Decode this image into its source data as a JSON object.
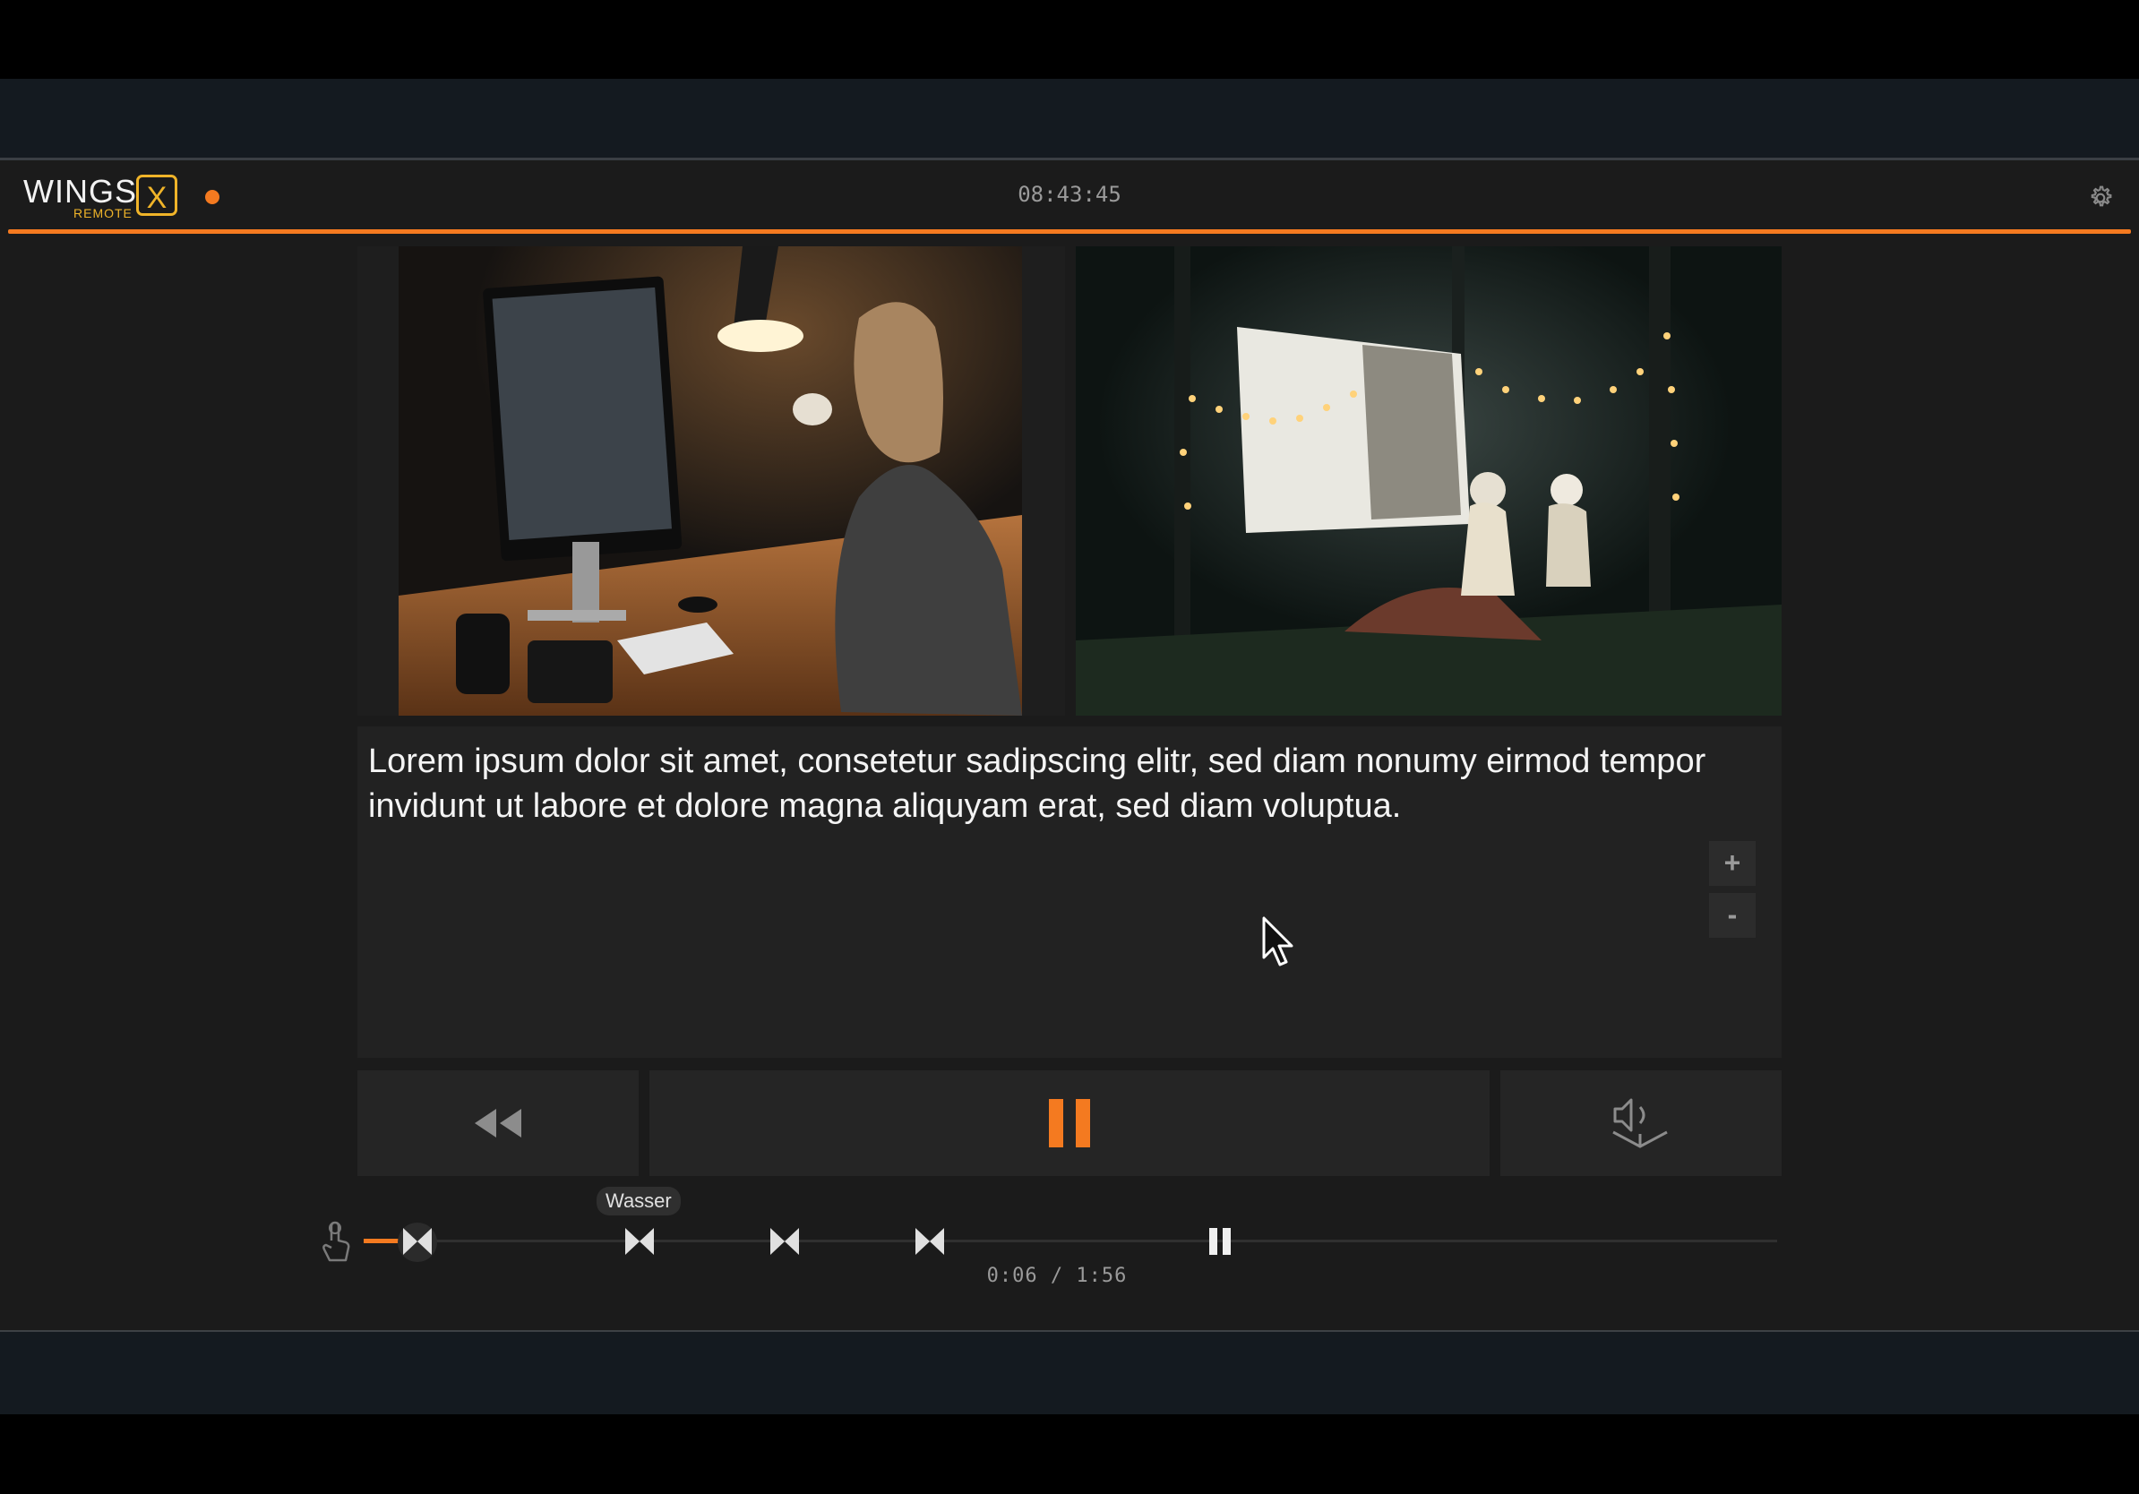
{
  "app": {
    "logo_word": "WINGS",
    "logo_sub": "REMOTE",
    "logo_x": "X",
    "clock": "08:43:45"
  },
  "media": {
    "images": [
      "Person at desk with iMac holding a mug",
      "Outdoor night movie screen in forest with lights"
    ]
  },
  "caption": {
    "text": "Lorem ipsum dolor sit amet, consetetur sadipscing elitr, sed diam nonumy eirmod tempor invidunt ut labore et dolore magna aliquyam erat, sed diam voluptua.",
    "zoom_in": "+",
    "zoom_out": "-"
  },
  "transport": {
    "state": "playing"
  },
  "timeline": {
    "marker_label": "Wasser",
    "time": "0:06 / 1:56",
    "position": 0.052
  },
  "pager": {
    "count": 2,
    "active": 0
  },
  "colors": {
    "accent": "#f47a20",
    "logo": "#f0b429",
    "background": "#1b1b1b",
    "panel": "#222222"
  }
}
